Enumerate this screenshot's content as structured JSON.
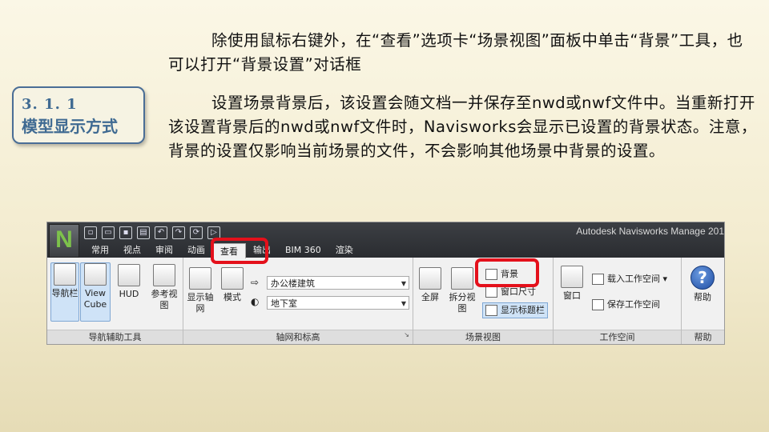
{
  "badge": {
    "number": "3. 1. 1",
    "title": "模型显示方式"
  },
  "paragraphs": {
    "p1": "除使用鼠标右键外，在“查看”选项卡“场景视图”面板中单击“背景”工具，也可以打开“背景设置”对话框",
    "p2": "设置场景背景后，该设置会随文档一并保存至nwd或nwf文件中。当重新打开该设置背景后的nwd或nwf文件时，Navisworks会显示已设置的背景状态。注意，背景的设置仅影响当前场景的文件，不会影响其他场景中背景的设置。"
  },
  "screenshot": {
    "app_logo": "N",
    "window_title": "Autodesk Navisworks Manage 201",
    "tabs": [
      "常用",
      "视点",
      "审阅",
      "动画",
      "查看",
      "输出",
      "BIM 360",
      "渲染"
    ],
    "active_tab": "查看",
    "panels": {
      "nav_aids": {
        "label": "导航辅助工具",
        "buttons": [
          "导航栏",
          "View Cube",
          "HUD",
          "参考视图"
        ]
      },
      "grids": {
        "label": "轴网和标高",
        "buttons": [
          "显示轴网",
          "模式"
        ],
        "combo_building": "办公楼建筑",
        "combo_level": "地下室"
      },
      "scene_view": {
        "label": "场景视图",
        "buttons": [
          "全屏",
          "拆分视图"
        ],
        "small_items": [
          "背景",
          "窗口尺寸",
          "显示标题栏"
        ]
      },
      "workspace": {
        "label": "工作空间",
        "buttons": [
          "窗口"
        ],
        "small_items": [
          "载入工作空间",
          "保存工作空间"
        ]
      },
      "help": {
        "label": "帮助",
        "buttons": [
          "帮助"
        ]
      }
    }
  },
  "colors": {
    "badge_border": "#4a6e96",
    "highlight": "#e4101b",
    "logo": "#7dc24b"
  }
}
